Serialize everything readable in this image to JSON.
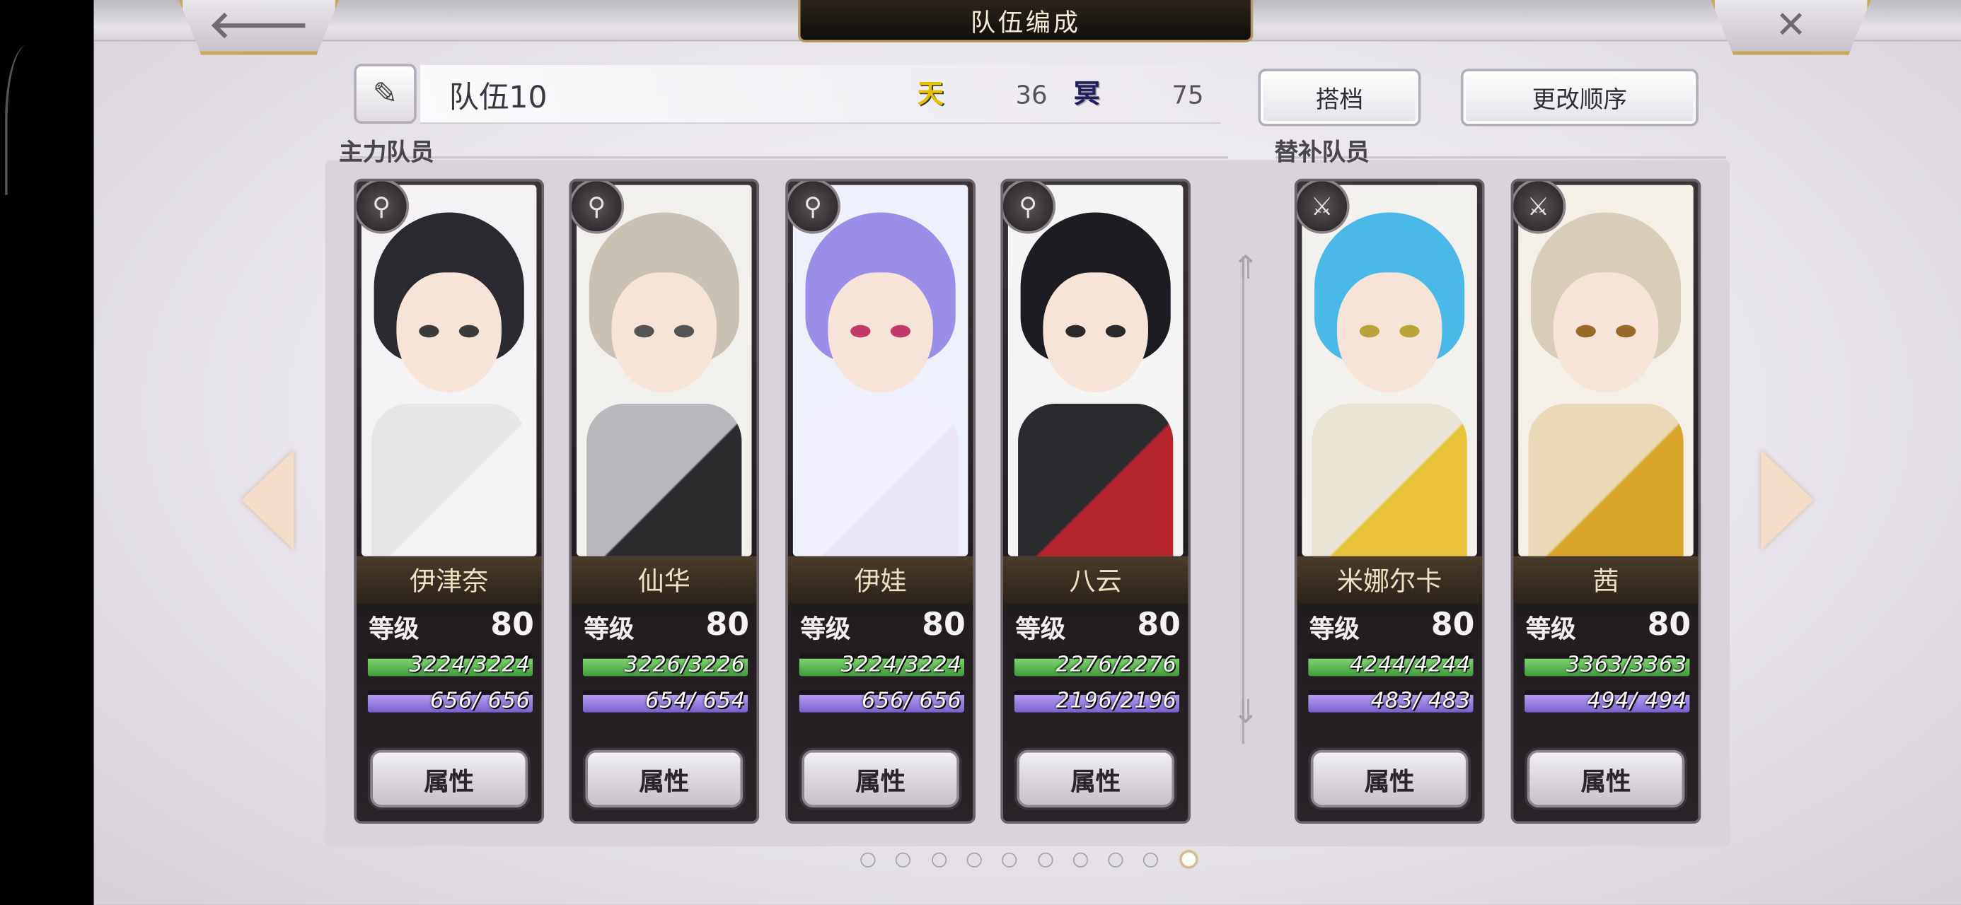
{
  "header": {
    "title": "队伍编成",
    "back_icon": "🡐",
    "close_icon": "✕"
  },
  "team": {
    "name": "队伍10",
    "edit_icon": "✎",
    "sky_icon_text": "天",
    "sky_value": "36",
    "dark_icon_text": "冥",
    "dark_value": "75"
  },
  "buttons": {
    "partner": "搭档",
    "reorder": "更改顺序"
  },
  "sections": {
    "main": "主力队员",
    "sub": "替补队员"
  },
  "level_label": "等级",
  "attr_label": "属性",
  "members": [
    {
      "name": "伊津奈",
      "class_icon": "staff-icon",
      "class_glyph": "⚲",
      "level": "80",
      "hp": "3224/3224",
      "hp_ratio": 1.0,
      "mp": "656/ 656",
      "mp_ratio": 1.0,
      "hair": "#2a2a30",
      "accent": "#f2f2f2",
      "body": "#e6e6e6",
      "eye": "#3b3b3b",
      "bg": "#f4f2f4"
    },
    {
      "name": "仙华",
      "class_icon": "staff-icon",
      "class_glyph": "⚲",
      "level": "80",
      "hp": "3226/3226",
      "hp_ratio": 1.0,
      "mp": "654/ 654",
      "mp_ratio": 1.0,
      "hair": "#c9c2b4",
      "accent": "#2b2b2e",
      "body": "#b9b9bd",
      "eye": "#555",
      "bg": "#f2f0ec"
    },
    {
      "name": "伊娃",
      "class_icon": "staff-icon",
      "class_glyph": "⚲",
      "level": "80",
      "hp": "3224/3224",
      "hp_ratio": 1.0,
      "mp": "656/ 656",
      "mp_ratio": 1.0,
      "hair": "#9b8ee8",
      "accent": "#e9e4f6",
      "body": "#f3eefb",
      "eye": "#c13a6a",
      "bg": "#eef0fb"
    },
    {
      "name": "八云",
      "class_icon": "staff-icon",
      "class_glyph": "⚲",
      "level": "80",
      "hp": "2276/2276",
      "hp_ratio": 1.0,
      "mp": "2196/2196",
      "mp_ratio": 1.0,
      "hair": "#1c1c22",
      "accent": "#b5232b",
      "body": "#2a2a2f",
      "eye": "#2a2a2a",
      "bg": "#f5f4f4"
    },
    {
      "name": "米娜尔卡",
      "class_icon": "sword-icon",
      "class_glyph": "⚔",
      "level": "80",
      "hp": "4244/4244",
      "hp_ratio": 1.0,
      "mp": "483/ 483",
      "mp_ratio": 1.0,
      "hair": "#4ab9e8",
      "accent": "#e8c23a",
      "body": "#e9e3d4",
      "eye": "#b9a43a",
      "bg": "#f3f1ee"
    },
    {
      "name": "茜",
      "class_icon": "sword-icon",
      "class_glyph": "⚔",
      "level": "80",
      "hp": "3363/3363",
      "hp_ratio": 1.0,
      "mp": "494/ 494",
      "mp_ratio": 1.0,
      "hair": "#d8cdb8",
      "accent": "#d9a52b",
      "body": "#e9d9b7",
      "eye": "#9a6a2a",
      "bg": "#f4efe7"
    }
  ],
  "pagination": {
    "count": 10,
    "active_index": 9
  }
}
